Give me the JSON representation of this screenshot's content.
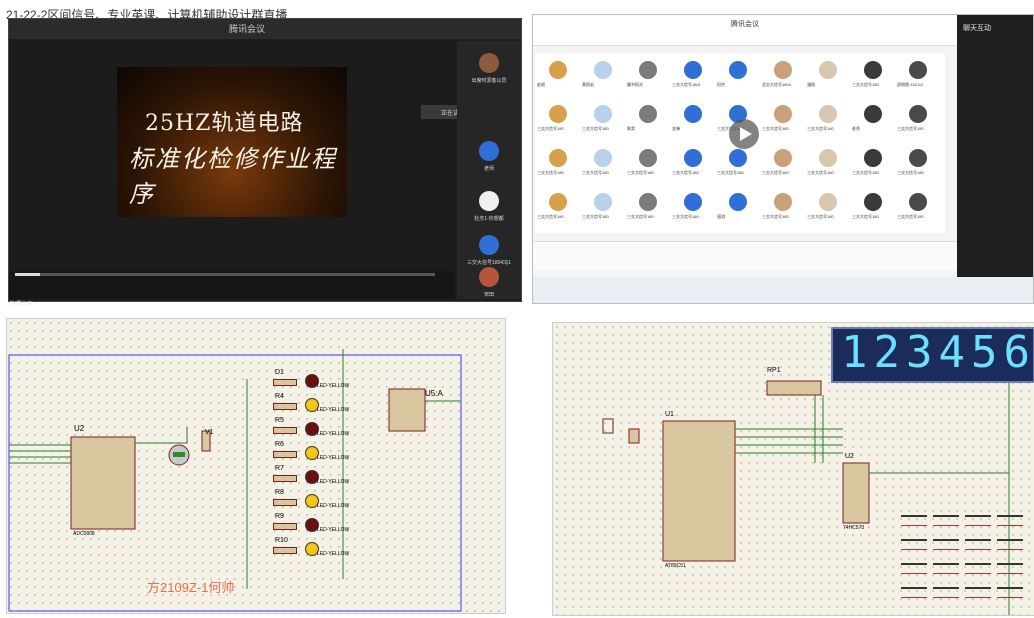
{
  "caption": "21-22-2区间信号、专业英课、计算机辅助设计群直播",
  "panel1": {
    "window_title": "腾讯会议",
    "video_title_line1": "25HZ轨道电路",
    "video_title_line2": "标准化检修作业程序",
    "popup_text": "正在讲话",
    "participants": [
      "出席时源客以员",
      "老师",
      "杜杰1-你想都",
      "三交大信号1804冯1",
      "宋田"
    ],
    "bottom_text": "快照共享"
  },
  "panel2": {
    "window_title": "腾讯会议",
    "chat_title": "聊天互动",
    "grid_names": [
      "赵斌",
      "黄照岩",
      "霸书阳光",
      "三交大信号1801",
      "田杰",
      "北交大信号1804",
      "潘翔",
      "三交大信号180",
      "邵朋朋-192112",
      "三交大信号180",
      "三交大信号180",
      "陈昊",
      "金锋",
      "三交大信号180",
      "三交大信号180",
      "三交大信号180",
      "老师",
      "三交大信号180",
      "三交大信号180",
      "三交大信号180",
      "三交大信号180",
      "三交大信号180",
      "三交大信号180",
      "三交大信号180",
      "三交大信号180",
      "三交大信号180",
      "三交大信号180",
      "三交大信号180",
      "三交大信号180",
      "三交大信号180",
      "三交大信号180",
      "银淇",
      "三交大信号180",
      "三交大信号180",
      "三交大信号180",
      "三交大信号180"
    ]
  },
  "panel3": {
    "chip_label": "U2",
    "chip_name": "ADC0808",
    "leds": [
      "D1",
      "R4",
      "R5",
      "R6",
      "R7",
      "R8",
      "R9",
      "R10"
    ],
    "led_caption": "LED-YELLOW",
    "voltmeter": "V1",
    "logic_label": "U5:A",
    "signature": "方2109Z-1何帅"
  },
  "panel4": {
    "display_digits": "123456",
    "resnet": "RP1",
    "mcu": "U1",
    "mcu_name": "AT89C51",
    "driver": "U2",
    "driver_name": "74HC573"
  }
}
